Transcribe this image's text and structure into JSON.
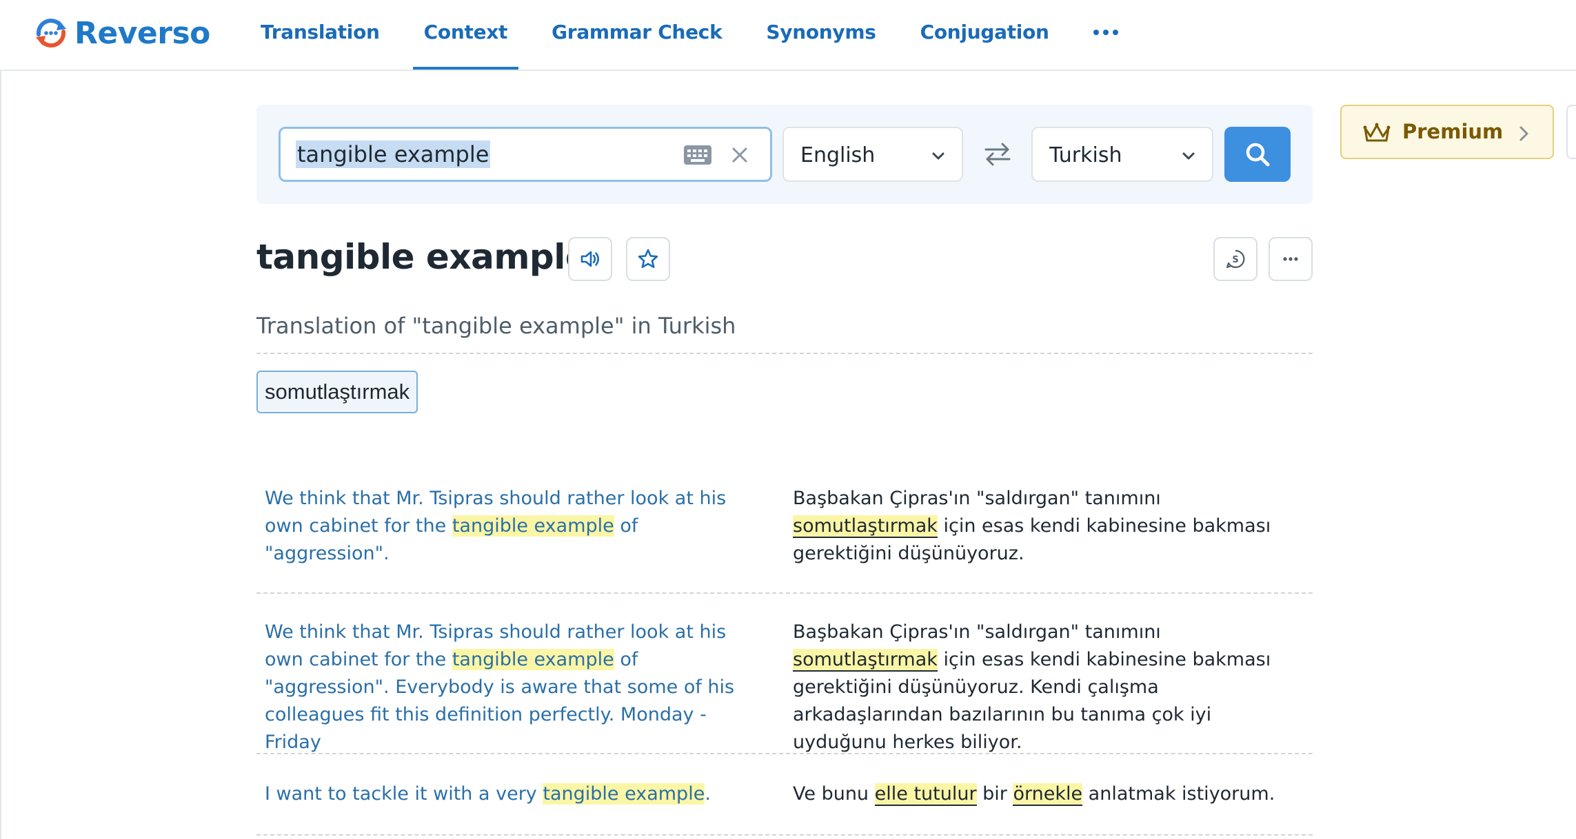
{
  "header": {
    "logo_text": "Reverso",
    "nav": [
      {
        "label": "Translation",
        "active": false
      },
      {
        "label": "Context",
        "active": true
      },
      {
        "label": "Grammar Check",
        "active": false
      },
      {
        "label": "Synonyms",
        "active": false
      },
      {
        "label": "Conjugation",
        "active": false
      }
    ],
    "more_icon": "more-dots-icon"
  },
  "search": {
    "query": "tangible example",
    "source_lang": "English",
    "target_lang": "Turkish",
    "icons": [
      "keyboard-icon",
      "clear-icon",
      "chevron-down-icon",
      "swap-icon",
      "search-icon"
    ]
  },
  "premium": {
    "label": "Premium",
    "icon": "crown-icon"
  },
  "result": {
    "title": "tangible example",
    "subtitle": "Translation of \"tangible example\" in Turkish",
    "translations": [
      "somutlaştırmak"
    ],
    "icons": [
      "speaker-icon",
      "star-icon",
      "synonyms-icon",
      "more-dots-icon"
    ]
  },
  "examples": [
    {
      "src": [
        {
          "t": "We think that Mr. Tsipras should rather look at his own cabinet for the "
        },
        {
          "t": "tangible example",
          "hl": true
        },
        {
          "t": " of \"aggression\"."
        }
      ],
      "trg": [
        {
          "t": "Başbakan Çipras'ın \"saldırgan\" tanımını "
        },
        {
          "t": "somutlaştırmak",
          "hl": true
        },
        {
          "t": " için esas kendi kabinesine bakması gerektiğini düşünüyoruz."
        }
      ]
    },
    {
      "src": [
        {
          "t": "We think that Mr. Tsipras should rather look at his own cabinet for the "
        },
        {
          "t": "tangible example",
          "hl": true
        },
        {
          "t": " of \"aggression\". Everybody is aware that some of his colleagues fit this definition perfectly. Monday - Friday"
        }
      ],
      "trg": [
        {
          "t": "Başbakan Çipras'ın \"saldırgan\" tanımını "
        },
        {
          "t": "somutlaştırmak",
          "hl": true
        },
        {
          "t": " için esas kendi kabinesine bakması gerektiğini düşünüyoruz. Kendi çalışma arkadaşlarından bazılarının bu tanıma çok iyi uyduğunu herkes biliyor."
        }
      ]
    },
    {
      "src": [
        {
          "t": "I want to tackle it with a very "
        },
        {
          "t": "tangible example",
          "hl": true
        },
        {
          "t": "."
        }
      ],
      "trg": [
        {
          "t": "Ve bunu "
        },
        {
          "t": "elle tutulur",
          "hl": true
        },
        {
          "t": " bir "
        },
        {
          "t": "örnekle",
          "hl": true
        },
        {
          "t": " anlatmak istiyorum."
        }
      ]
    }
  ]
}
